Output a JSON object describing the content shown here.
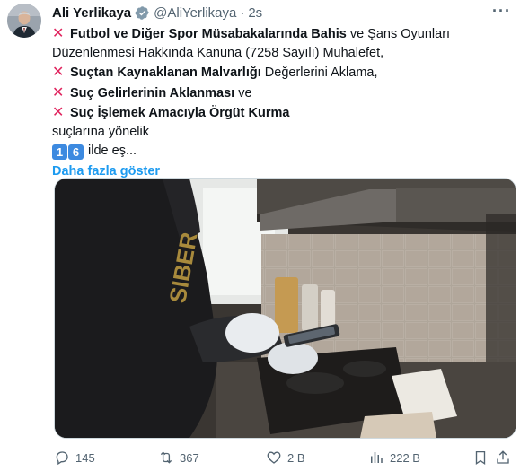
{
  "tweet": {
    "author_name": "Ali Yerlikaya",
    "handle": "@AliYerlikaya",
    "separator": "·",
    "time": "2s",
    "more_label": "···",
    "lines": {
      "l1_bold": "Futbol ve Diğer Spor Müsabakalarında Bahis",
      "l1_rest": " ve Şans Oyunları",
      "l2": "Düzenlenmesi Hakkında Kanuna (7258 Sayılı) Muhalefet,",
      "l3_bold": "Suçtan Kaynaklanan Malvarlığı",
      "l3_rest": " Değerlerini Aklama,",
      "l4_bold": "Suç Gelirlerinin Aklanması",
      "l4_rest": " ve",
      "l5_bold": "Suç İşlemek Amacıyla Örgüt Kurma",
      "l6": "suçlarına yönelik",
      "keycap_1": "1",
      "keycap_2": "6",
      "l7_rest": " ilde eş...",
      "x_mark": "✕"
    },
    "show_more": "Daha fazla göster"
  },
  "media": {
    "vest_text": "SIBER"
  },
  "actions": {
    "replies": "145",
    "reposts": "367",
    "likes": "2 B",
    "views": "222 B"
  },
  "colors": {
    "accent": "#1d9bf0",
    "x_mark": "#e0245e",
    "keycap": "#3d8ae0",
    "muted": "#536471"
  }
}
